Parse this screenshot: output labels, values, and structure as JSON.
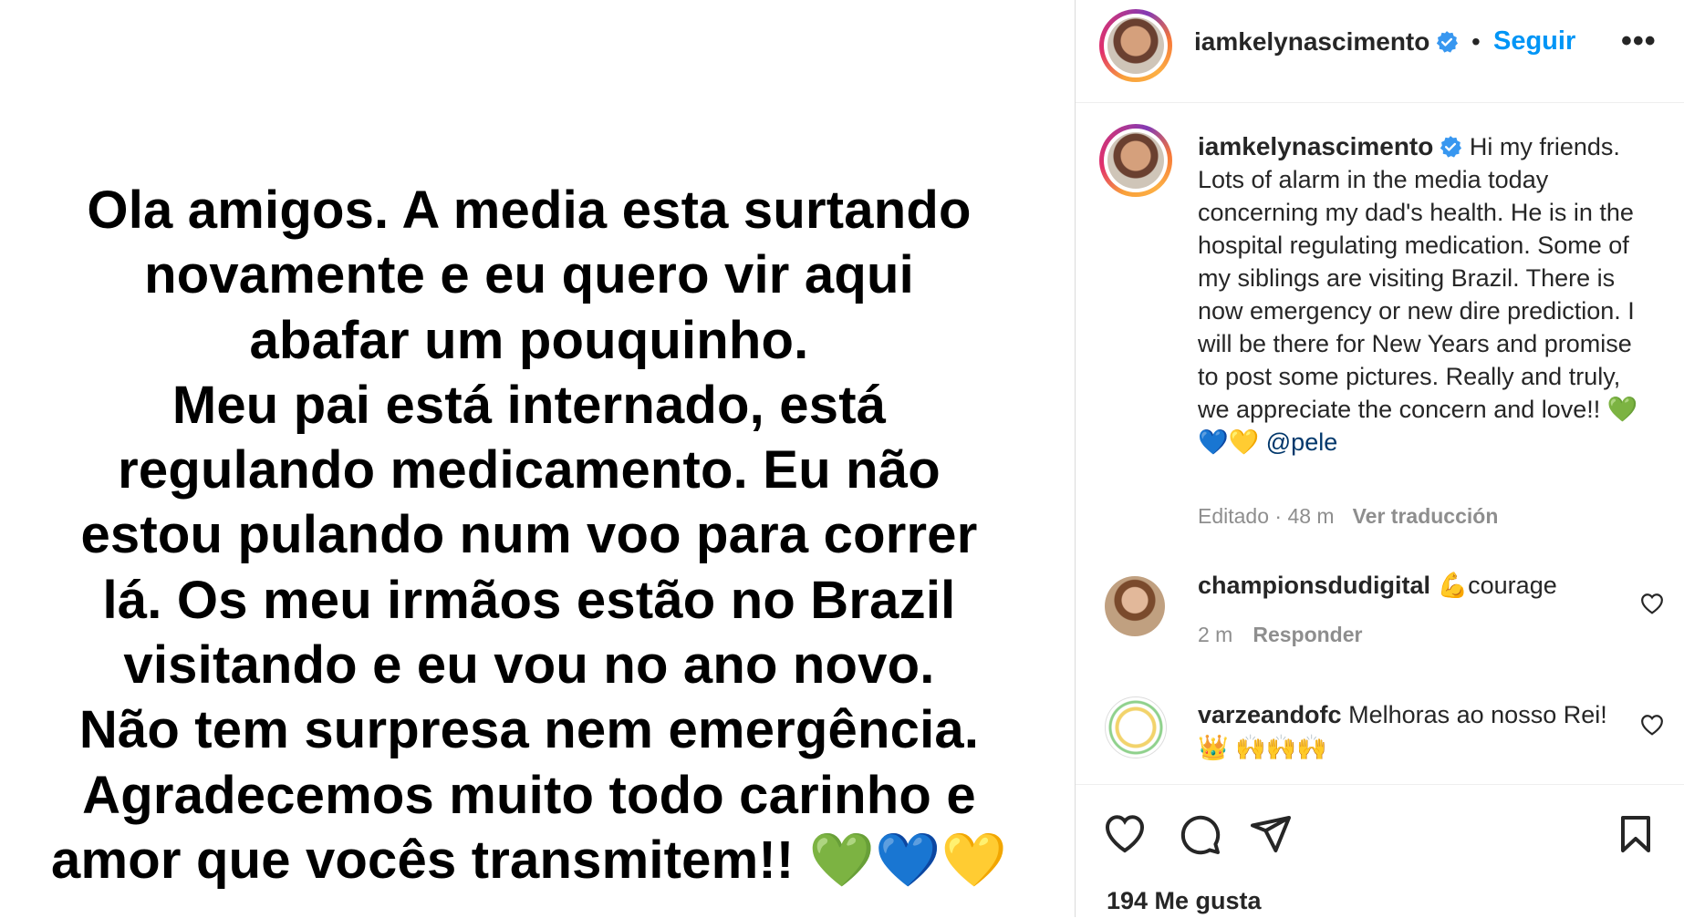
{
  "post": {
    "lines": [
      "Ola amigos. A media esta surtando",
      "novamente e eu quero vir aqui",
      "abafar um pouquinho.",
      "Meu pai está internado, está",
      "regulando medicamento. Eu não",
      "estou pulando num voo para correr",
      "lá. Os meu irmãos estão no Brazil",
      "visitando e eu vou no ano novo.",
      "Não tem surpresa nem emergência.",
      "Agradecemos muito todo carinho e",
      "amor que vocês transmitem!! 💚💙💛"
    ]
  },
  "header": {
    "username": "iamkelynascimento",
    "separator": "•",
    "follow_label": "Seguir",
    "more_label": "•••"
  },
  "caption": {
    "username": "iamkelynascimento",
    "text": "Hi my friends. Lots of alarm in the media today concerning my dad's health. He is in the hospital regulating medication. Some of my siblings are visiting Brazil. There is now emergency or new dire prediction. I will be there for New Years and promise to post some pictures. Really and truly, we appreciate the concern and love!! 💚💙💛",
    "mention": "@pele",
    "meta": "Editado · 48 m",
    "translate_label": "Ver traducción"
  },
  "comments": [
    {
      "username": "championsdudigital",
      "text": "💪courage",
      "time": "2 m",
      "reply_label": "Responder"
    },
    {
      "username": "varzeandofc",
      "text": "Melhoras ao nosso Rei! 👑 🙌🙌🙌"
    }
  ],
  "footer": {
    "likes": "194 Me gusta"
  },
  "colors": {
    "accent": "#0095f6",
    "text": "#262626",
    "muted": "#8e8e8e",
    "mention": "#00376b",
    "verified": "#3897f0"
  }
}
